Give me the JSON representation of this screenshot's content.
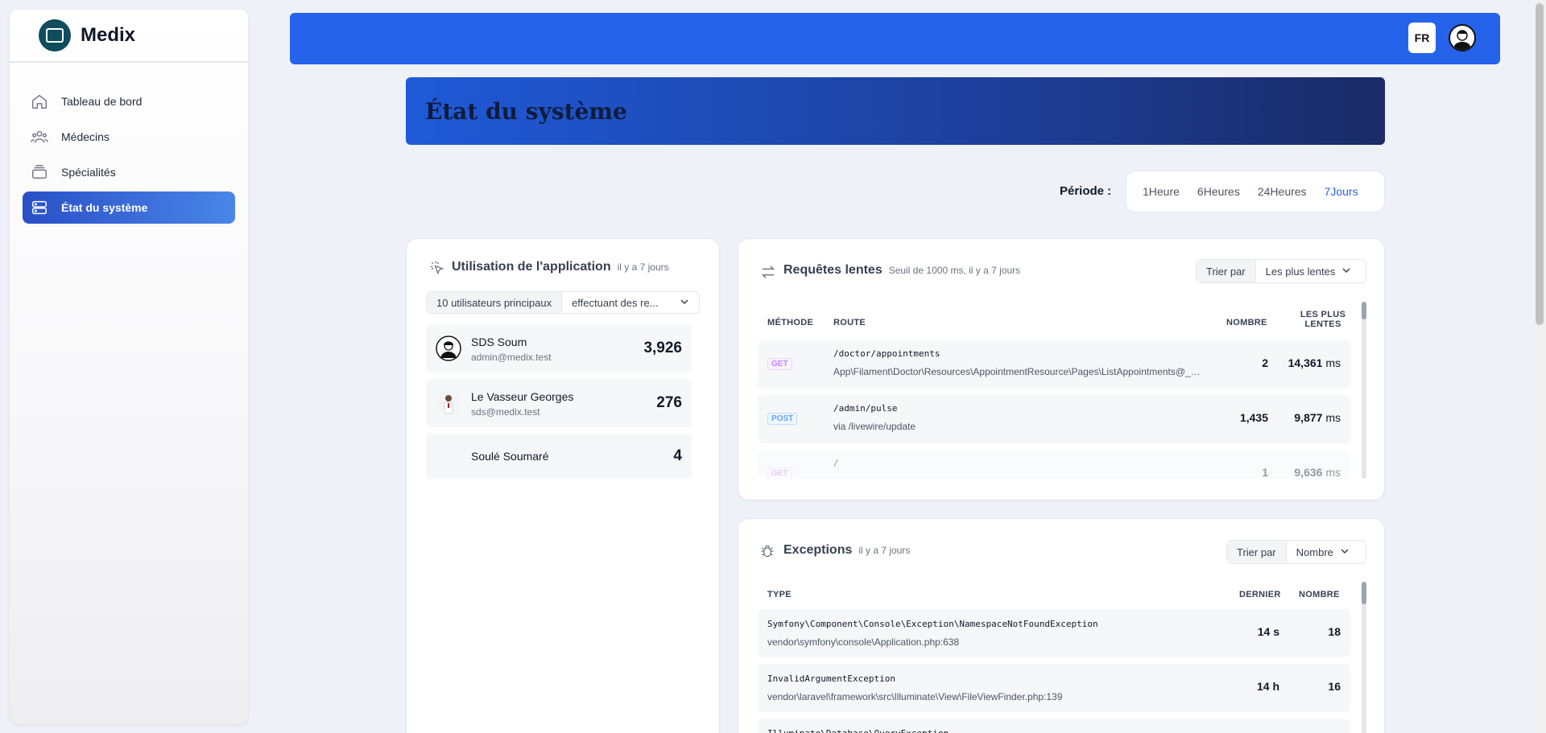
{
  "brand": {
    "name": "Medix"
  },
  "sidebar": {
    "items": [
      {
        "label": "Tableau de bord",
        "icon": "home-icon"
      },
      {
        "label": "Médecins",
        "icon": "users-icon"
      },
      {
        "label": "Spécialités",
        "icon": "layers-icon"
      },
      {
        "label": "État du système",
        "icon": "server-icon",
        "active": true
      }
    ]
  },
  "topbar": {
    "lang": "FR"
  },
  "page": {
    "title": "État du système"
  },
  "period": {
    "label": "Période :",
    "options": [
      "1Heure",
      "6Heures",
      "24Heures",
      "7Jours"
    ],
    "selected": "7Jours"
  },
  "usage": {
    "title": "Utilisation de l'application",
    "sub": "il y a 7 jours",
    "select_left": "10 utilisateurs principaux",
    "select_right": "effectuant des re...",
    "users": [
      {
        "name": "SDS Soum",
        "email": "admin@medix.test",
        "count": "3,926"
      },
      {
        "name": "Le Vasseur Georges",
        "email": "sds@medix.test",
        "count": "276"
      },
      {
        "name": "Soulé Soumaré",
        "email": "",
        "count": "4"
      }
    ]
  },
  "slow_queries": {
    "title": "Requêtes lentes",
    "sub": "Seuil de 1000 ms, il y a 7 jours",
    "sort_label": "Trier par",
    "sort_value": "Les plus lentes",
    "headers": {
      "method": "MÉTHODE",
      "route": "ROUTE",
      "count": "NOMBRE",
      "slowest_1": "LES PLUS",
      "slowest_2": "LENTES"
    },
    "rows": [
      {
        "method": "GET",
        "route": "/doctor/appointments",
        "sub": "App\\Filament\\Doctor\\Resources\\AppointmentResource\\Pages\\ListAppointments@__i...",
        "count": "2",
        "slowest": "14,361",
        "unit": "ms"
      },
      {
        "method": "POST",
        "route": "/admin/pulse",
        "sub": "via /livewire/update",
        "count": "1,435",
        "slowest": "9,877",
        "unit": "ms"
      },
      {
        "method": "GET",
        "route": "/",
        "sub": "",
        "count": "1",
        "slowest": "9,636",
        "unit": "ms"
      }
    ]
  },
  "exceptions": {
    "title": "Exceptions",
    "sub": "il y a 7 jours",
    "sort_label": "Trier par",
    "sort_value": "Nombre",
    "headers": {
      "type": "TYPE",
      "last": "DERNIER",
      "count": "NOMBRE"
    },
    "rows": [
      {
        "type": "Symfony\\Component\\Console\\Exception\\NamespaceNotFoundException",
        "loc": "vendor\\symfony\\console\\Application.php:638",
        "last": "14 s",
        "count": "18"
      },
      {
        "type": "InvalidArgumentException",
        "loc": "vendor\\laravel\\framework\\src\\Illuminate\\View\\FileViewFinder.php:139",
        "last": "14 h",
        "count": "16"
      },
      {
        "type": "Illuminate\\Database\\QueryException",
        "loc": "",
        "last": "",
        "count": ""
      }
    ]
  },
  "colors": {
    "accent": "#2563eb",
    "active_nav": "#2a4fc7"
  }
}
